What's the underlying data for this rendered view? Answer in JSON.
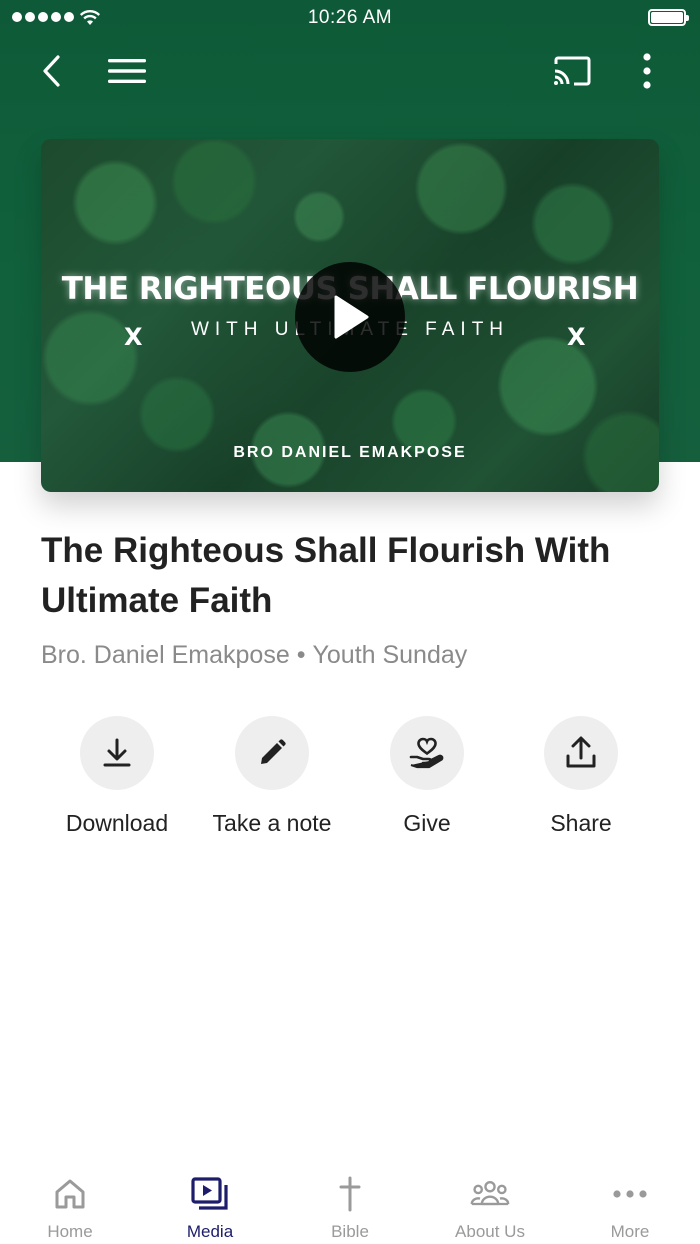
{
  "status_bar": {
    "time": "10:26 AM"
  },
  "colors": {
    "header_green": "#11613c",
    "active_tab": "#1d1d6b",
    "inactive_tab": "#9a9a9a"
  },
  "icons": {
    "back": "chevron-left-icon",
    "menu": "hamburger-icon",
    "cast": "cast-icon",
    "more": "more-vertical-icon",
    "play": "play-icon"
  },
  "video": {
    "title_text": "THE RIGHTEOUS SHALL FLOURISH",
    "subtitle_text": "WITH  ULTIMATE  FAITH",
    "mark_left": "X",
    "mark_right": "X",
    "speaker_text": "BRO DANIEL EMAKPOSE"
  },
  "sermon": {
    "title": "The Righteous Shall Flourish With Ultimate Faith",
    "speaker": "Bro. Daniel Emakpose",
    "separator": "•",
    "series": "Youth Sunday"
  },
  "actions": [
    {
      "label": "Download",
      "icon": "download-icon"
    },
    {
      "label": "Take a note",
      "icon": "pencil-icon"
    },
    {
      "label": "Give",
      "icon": "give-heart-hand-icon"
    },
    {
      "label": "Share",
      "icon": "share-icon"
    }
  ],
  "tabs": [
    {
      "label": "Home",
      "icon": "home-icon"
    },
    {
      "label": "Media",
      "icon": "media-icon",
      "active": true
    },
    {
      "label": "Bible",
      "icon": "cross-icon"
    },
    {
      "label": "About Us",
      "icon": "people-icon"
    },
    {
      "label": "More",
      "icon": "more-horizontal-icon"
    }
  ]
}
